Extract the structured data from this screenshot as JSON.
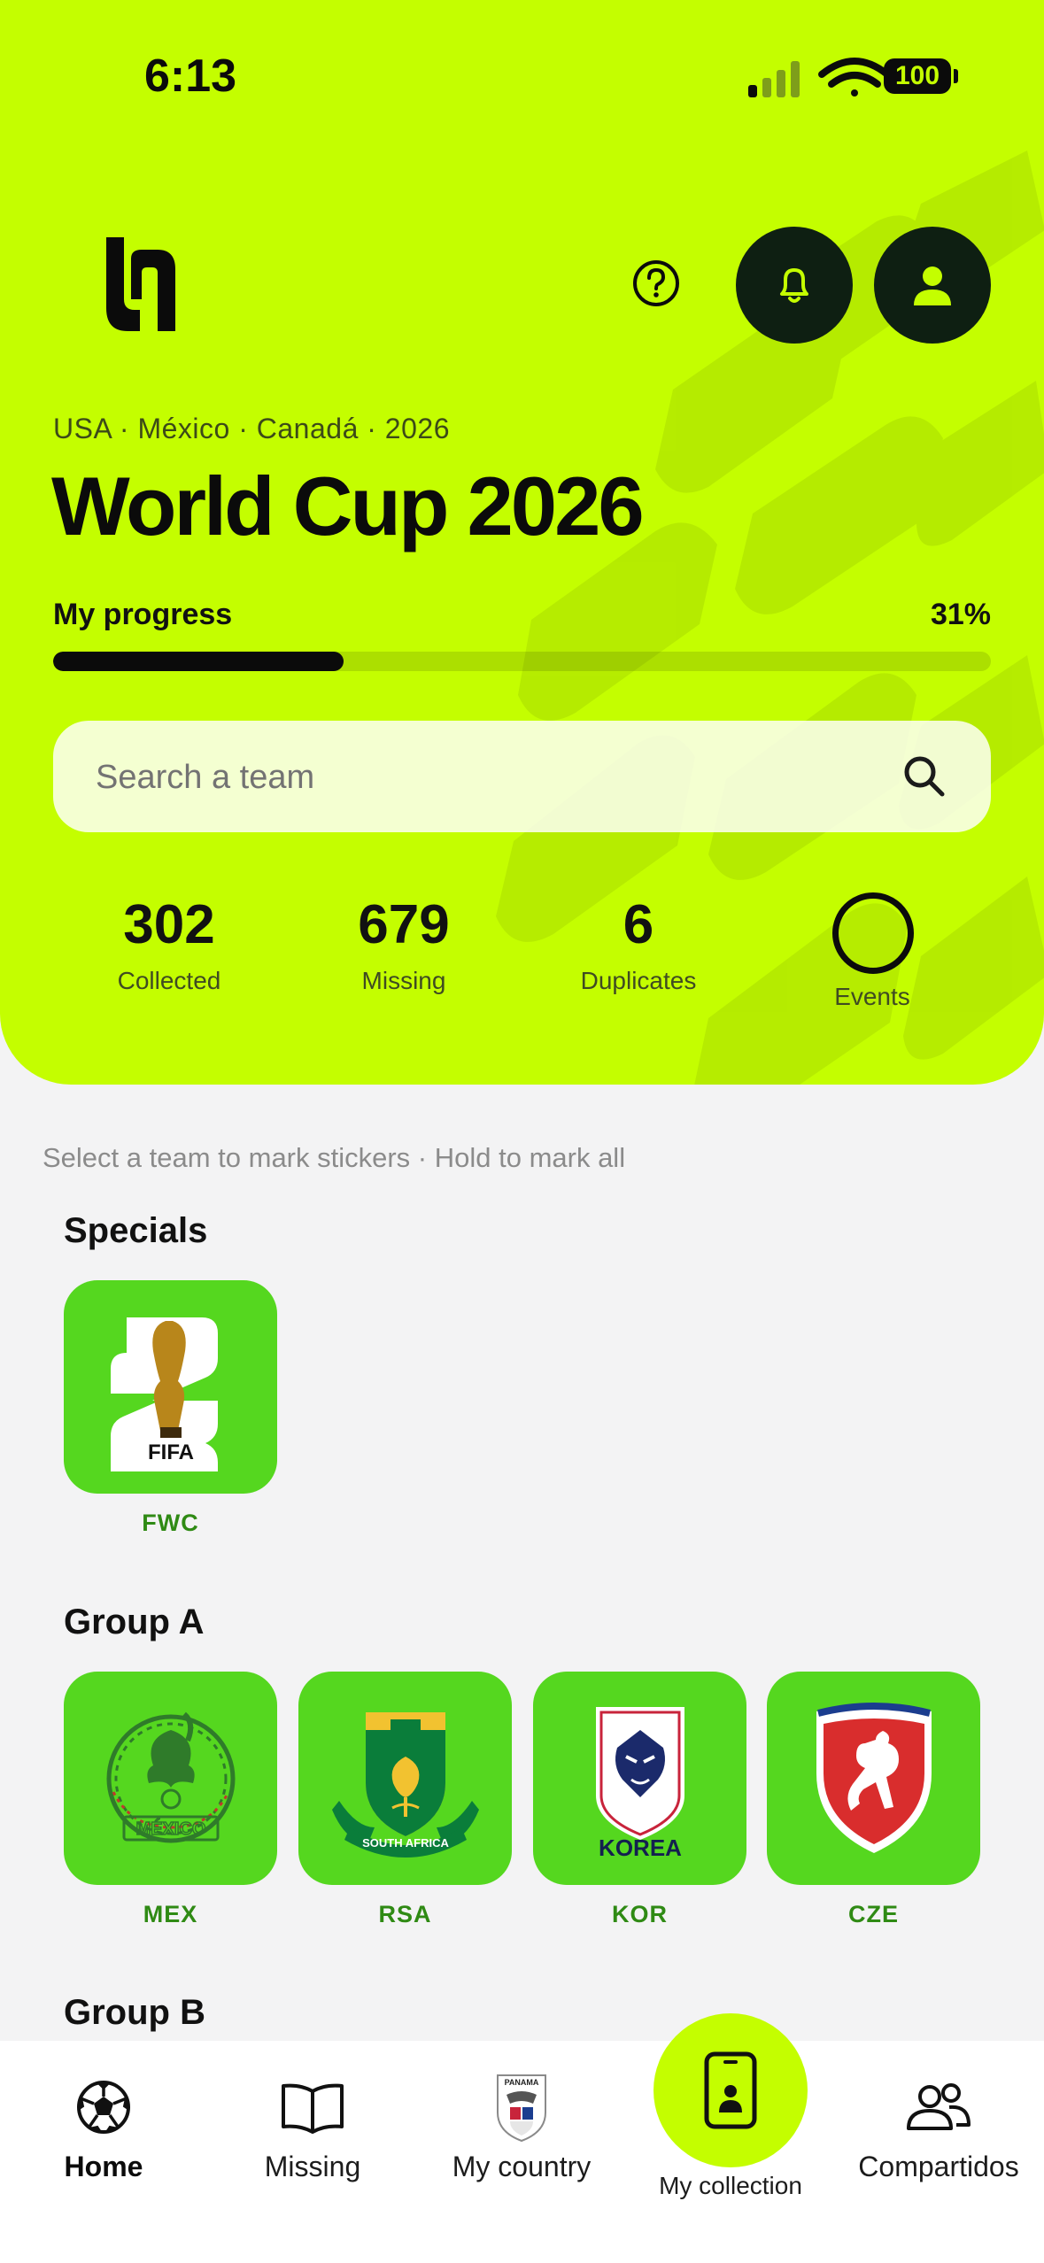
{
  "status_bar": {
    "time": "6:13",
    "battery": "100"
  },
  "header": {
    "hosts": "USA · México · Canadá · 2026",
    "title": "World Cup 2026",
    "progress_label": "My progress",
    "progress_percent_text": "31%",
    "progress_fraction": 0.31
  },
  "search": {
    "placeholder": "Search a team"
  },
  "stats": [
    {
      "value": "302",
      "label": "Collected"
    },
    {
      "value": "679",
      "label": "Missing"
    },
    {
      "value": "6",
      "label": "Duplicates"
    },
    {
      "value": "",
      "label": "Events"
    }
  ],
  "hint": "Select a team to mark stickers · Hold to mark all",
  "sections": [
    {
      "title": "Specials",
      "teams": [
        {
          "code": "FWC",
          "icon": "fifa-world-cup-2026-emblem"
        }
      ]
    },
    {
      "title": "Group A",
      "teams": [
        {
          "code": "MEX",
          "icon": "mexico-crest"
        },
        {
          "code": "RSA",
          "icon": "south-africa-crest",
          "crest_text": "SOUTH AFRICA"
        },
        {
          "code": "KOR",
          "icon": "korea-crest",
          "crest_text": "KOREA"
        },
        {
          "code": "CZE",
          "icon": "czech-crest"
        }
      ]
    },
    {
      "title": "Group B",
      "teams": []
    }
  ],
  "crest_text": {
    "fwc": "FIFA",
    "mex": "MÉXICO",
    "rsa": "SOUTH AFRICA",
    "kor": "KOREA",
    "pan": "PANAMA"
  },
  "nav": {
    "items": [
      {
        "label": "Home",
        "icon": "soccer-ball-icon",
        "active": true
      },
      {
        "label": "Missing",
        "icon": "open-book-icon"
      },
      {
        "label": "My country",
        "icon": "panama-crest-icon"
      },
      {
        "label": "My collection",
        "icon": "phone-card-icon"
      },
      {
        "label": "Compartidos",
        "icon": "people-icon"
      }
    ]
  },
  "colors": {
    "accent": "#c4fe00",
    "tile": "#55d71f",
    "code_text": "#2f8a14",
    "dark": "#0b0b0b"
  }
}
